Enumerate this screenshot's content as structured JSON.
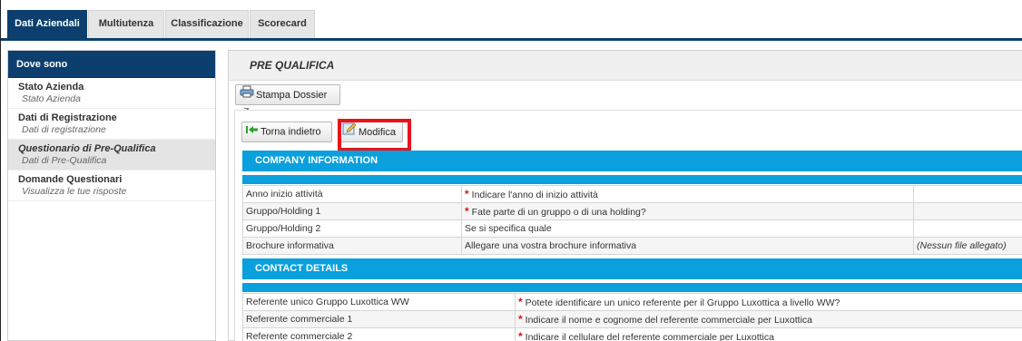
{
  "tabs": [
    {
      "label": "Dati Aziendali"
    },
    {
      "label": "Multiutenza"
    },
    {
      "label": "Classificazione"
    },
    {
      "label": "Scorecard"
    }
  ],
  "sidebar": {
    "title": "Dove sono",
    "items": [
      {
        "title": "Stato Azienda",
        "subtitle": "Stato Azienda"
      },
      {
        "title": "Dati di Registrazione",
        "subtitle": "Dati di registrazione"
      },
      {
        "title": "Questionario di Pre-Qualifica",
        "subtitle": "Dati di Pre-Qualifica"
      },
      {
        "title": "Domande Questionari",
        "subtitle": "Visualizza le tue risposte"
      }
    ]
  },
  "main": {
    "title": "PRE QUALIFICA",
    "print_button": "Stampa Dossier",
    "back_button": "Torna indietro",
    "edit_button": "Modifica"
  },
  "company": {
    "header": "COMPANY INFORMATION",
    "rows": [
      {
        "label": "Anno inizio attività",
        "question": "Indicare l'anno di inizio attività",
        "required": true,
        "value": ""
      },
      {
        "label": "Gruppo/Holding 1",
        "question": "Fate parte di un gruppo o di una holding?",
        "required": true,
        "value": ""
      },
      {
        "label": "Gruppo/Holding 2",
        "question": "Se si specifica quale",
        "required": false,
        "value": ""
      },
      {
        "label": "Brochure informativa",
        "question": "Allegare una vostra brochure informativa",
        "required": false,
        "value": "(Nessun file allegato)"
      }
    ]
  },
  "contact": {
    "header": "CONTACT DETAILS",
    "rows": [
      {
        "label": "Referente unico Gruppo Luxottica WW",
        "question": "Potete identificare un unico referente per il Gruppo Luxottica a livello WW?",
        "required": true
      },
      {
        "label": "Referente commerciale 1",
        "question": "Indicare il nome e cognome del referente commerciale per Luxottica",
        "required": true
      },
      {
        "label": "Referente commerciale 2",
        "question": "Indicare il cellulare del referente commerciale per Luxottica",
        "required": true
      }
    ]
  },
  "colors": {
    "navy": "#0c3f6e",
    "section_blue": "#0aa0de",
    "highlight_red": "#e8141c",
    "required_star": "#d9141c"
  },
  "icons": {
    "print": "printer-icon",
    "external": "external-link-icon",
    "back": "back-arrow-icon",
    "edit": "edit-icon",
    "required": "required-star-icon"
  }
}
